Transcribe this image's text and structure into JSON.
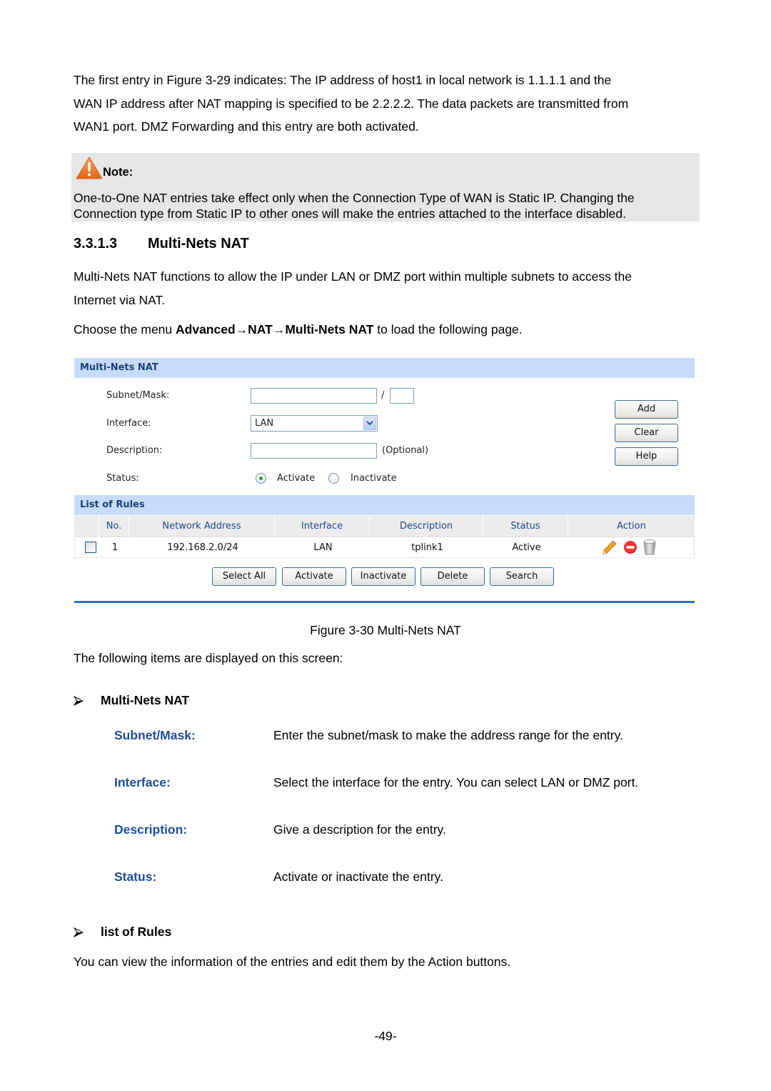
{
  "intro": {
    "line1": "The first entry in Figure 3-29 indicates: The IP address of host1 in local network is 1.1.1.1 and the",
    "line2": "WAN IP address after NAT mapping is specified to be 2.2.2.2. The data packets are transmitted from",
    "line3": "WAN1 port. DMZ Forwarding and this entry are both activated."
  },
  "note": {
    "icon": "warning-triangle-icon",
    "title": "Note:",
    "line1": "One-to-One NAT entries take effect only when the Connection Type of WAN is Static IP. Changing the",
    "line2": "Connection type from Static IP to other ones will make the entries attached to the interface disabled."
  },
  "section": {
    "number": "3.3.1.3",
    "title": "Multi-Nets NAT",
    "desc_line1": "Multi-Nets NAT functions to allow the IP under LAN or DMZ port within multiple subnets to access the",
    "desc_line2": "Internet via NAT.",
    "menu_prefix": "Choose the menu ",
    "menu_path": "Advanced→NAT→Multi-Nets NAT",
    "menu_suffix": " to load the following page."
  },
  "figure": {
    "panel_title": "Multi-Nets NAT",
    "form": {
      "subnet_label": "Subnet/Mask:",
      "subnet_value": "",
      "mask_separator": "/",
      "mask_value": "",
      "interface_label": "Interface:",
      "interface_selected": "LAN",
      "description_label": "Description:",
      "description_value": "",
      "optional_hint": "(Optional)",
      "status_label": "Status:",
      "status_options": [
        "Activate",
        "Inactivate"
      ],
      "status_selected": "Activate"
    },
    "buttons": {
      "add": "Add",
      "clear": "Clear",
      "help": "Help"
    },
    "list_title": "List of Rules",
    "table": {
      "columns": [
        "",
        "No.",
        "Network Address",
        "Interface",
        "Description",
        "Status",
        "Action"
      ],
      "rows": [
        {
          "checked": false,
          "no": "1",
          "network_address": "192.168.2.0/24",
          "interface": "LAN",
          "description": "tplink1",
          "status": "Active",
          "actions": [
            "edit-pencil-icon",
            "disable-icon",
            "delete-trash-icon"
          ]
        }
      ]
    },
    "bottom_buttons": {
      "select_all": "Select All",
      "activate": "Activate",
      "inactivate": "Inactivate",
      "delete": "Delete",
      "search": "Search"
    }
  },
  "caption": "Figure 3-30 Multi-Nets NAT",
  "items_intro": "The following items are displayed on this screen:",
  "group1": {
    "heading": "Multi-Nets NAT",
    "items": [
      {
        "term": "Subnet/Mask:",
        "def": "Enter the subnet/mask to make the address range for the entry."
      },
      {
        "term": "Interface:",
        "def": "Select the interface for the entry. You can select LAN or DMZ port."
      },
      {
        "term": "Description:",
        "def": "Give a description for the entry."
      },
      {
        "term": "Status:",
        "def": "Activate or inactivate the entry."
      }
    ]
  },
  "group2": {
    "heading": "list of Rules",
    "text": "You can view the information of the entries and edit them by the Action buttons."
  },
  "page_number": "-49-",
  "colors": {
    "panel_header_bg": "#c6dcf9",
    "panel_header_text": "#1f3f78",
    "term_blue": "#1e4d9c",
    "note_bg": "#e6e6e6",
    "warning_orange": "#e8731c"
  }
}
